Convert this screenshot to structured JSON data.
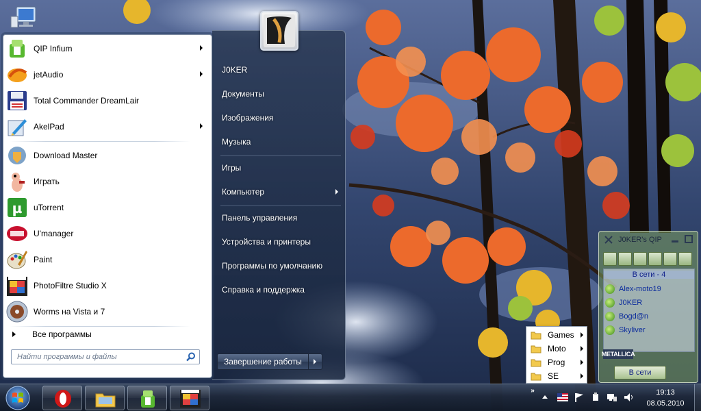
{
  "start_menu": {
    "programs": [
      {
        "label": "QIP Infium",
        "icon": "qip-icon",
        "has_submenu": true
      },
      {
        "label": "jetAudio",
        "icon": "jetaudio-icon",
        "has_submenu": true
      },
      {
        "label": "Total Commander DreamLair",
        "icon": "floppy-icon",
        "has_submenu": false
      },
      {
        "label": "AkelPad",
        "icon": "akelpad-icon",
        "has_submenu": true
      },
      {
        "label": "Download Master",
        "icon": "download-master-icon",
        "has_submenu": false
      },
      {
        "label": "Играть",
        "icon": "worms-icon",
        "has_submenu": false
      },
      {
        "label": "uTorrent",
        "icon": "utorrent-icon",
        "has_submenu": false
      },
      {
        "label": "U'manager",
        "icon": "utel-icon",
        "has_submenu": false
      },
      {
        "label": "Paint",
        "icon": "paint-icon",
        "has_submenu": false
      },
      {
        "label": "PhotoFiltre Studio X",
        "icon": "photofiltre-icon",
        "has_submenu": false
      },
      {
        "label": "Worms на Vista и 7",
        "icon": "worms-disc-icon",
        "has_submenu": false
      }
    ],
    "all_programs": "Все программы",
    "search_placeholder": "Найти программы и файлы",
    "places": [
      {
        "label": "J0KER",
        "has_submenu": false
      },
      {
        "label": "Документы",
        "has_submenu": false
      },
      {
        "label": "Изображения",
        "has_submenu": false
      },
      {
        "label": "Музыка",
        "has_submenu": false
      },
      {
        "label": "Игры",
        "has_submenu": false
      },
      {
        "label": "Компьютер",
        "has_submenu": true
      },
      {
        "label": "Панель управления",
        "has_submenu": false
      },
      {
        "label": "Устройства и принтеры",
        "has_submenu": false
      },
      {
        "label": "Программы по умолчанию",
        "has_submenu": false
      },
      {
        "label": "Справка и поддержка",
        "has_submenu": false
      }
    ],
    "shutdown_label": "Завершение работы"
  },
  "folder_popup": [
    {
      "label": "Games"
    },
    {
      "label": "Moto"
    },
    {
      "label": "Prog"
    },
    {
      "label": "SE"
    }
  ],
  "qip": {
    "title": "J0KER's QIP",
    "group": "В сети - 4",
    "contacts": [
      "Alex-moto19",
      "J0KER",
      "Bogd@n",
      "Skyliver"
    ],
    "logo": "METALLICA",
    "status": "В сети"
  },
  "taskbar": {
    "pinned": [
      "opera-icon",
      "explorer-folder-icon",
      "qip-icon",
      "photofiltre-icon"
    ],
    "tray_expand": "»",
    "tray_icons": [
      "language-flag-icon",
      "action-center-flag-icon",
      "usb-icon",
      "network-icon",
      "volume-icon"
    ]
  },
  "clock": {
    "time": "19:13",
    "date": "08.05.2010"
  },
  "colors": {
    "menu_left_bg": "#ffffff",
    "menu_right_bg": "#26384f",
    "taskbar": "#1a2638",
    "qip_panel": "#7da05f"
  }
}
